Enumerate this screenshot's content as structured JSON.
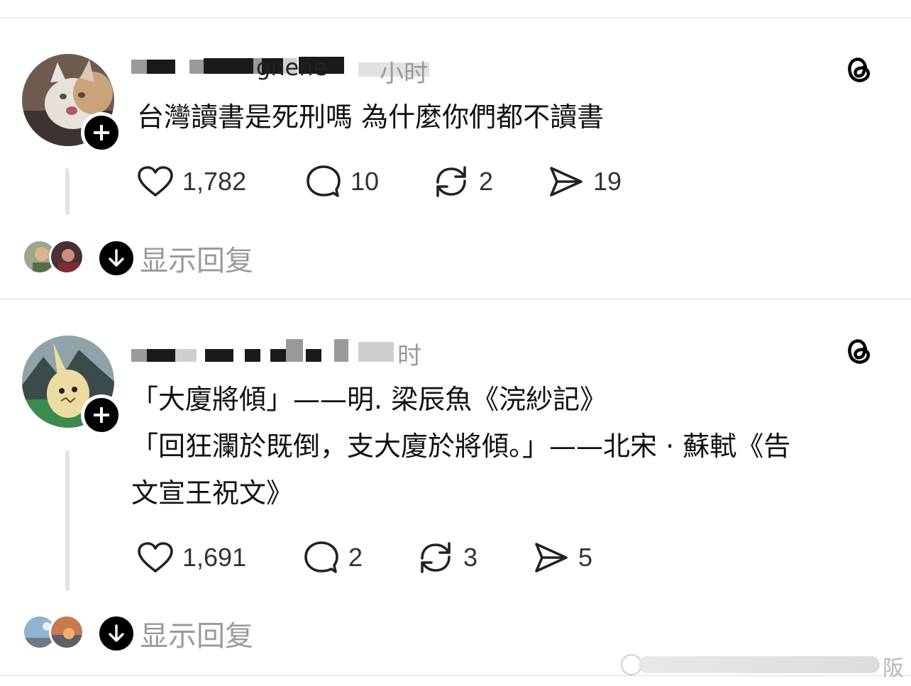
{
  "posts": [
    {
      "username_fragment": "gnene",
      "time": "小时",
      "content": "台灣讀書是死刑嗎 為什麼你們都不讀書",
      "likes": "1,782",
      "comments": "10",
      "reposts": "2",
      "shares": "19",
      "show_replies": "显示回复"
    },
    {
      "time": "时",
      "content": "「大廈將傾」——明. 梁辰魚《浣紗記》\n「回狂瀾於既倒，支大廈於將傾。」——北宋 · 蘇軾《告\n文宣王祝文》",
      "likes": "1,691",
      "comments": "2",
      "reposts": "3",
      "shares": "5",
      "show_replies": "显示回复"
    }
  ],
  "watermark": "阪"
}
